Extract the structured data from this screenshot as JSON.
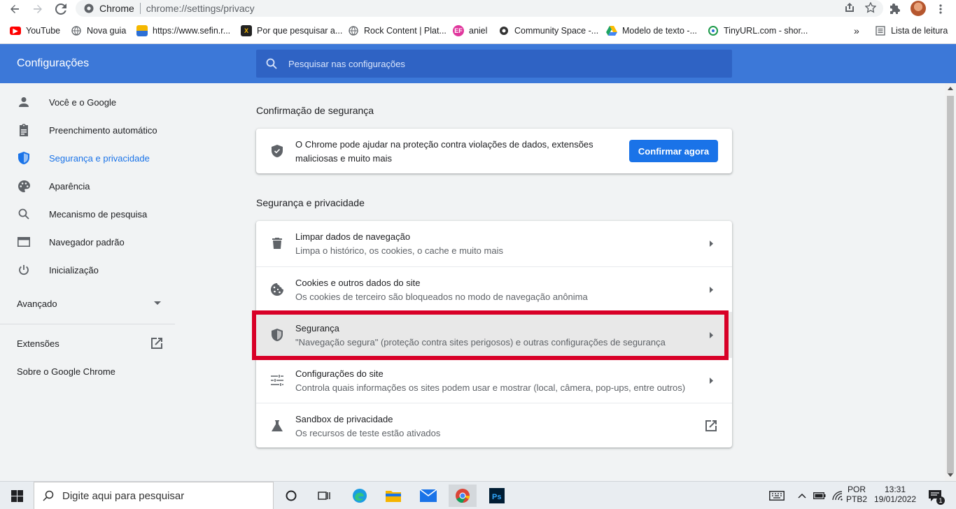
{
  "browser": {
    "site_name": "Chrome",
    "url": "chrome://settings/privacy"
  },
  "bookmarks": [
    {
      "label": "YouTube"
    },
    {
      "label": "Nova guia"
    },
    {
      "label": "https://www.sefin.r..."
    },
    {
      "label": "Por que pesquisar a..."
    },
    {
      "label": "Rock Content | Plat..."
    },
    {
      "label": "aniel"
    },
    {
      "label": "Community Space -..."
    },
    {
      "label": "Modelo de texto -..."
    },
    {
      "label": "TinyURL.com - shor..."
    }
  ],
  "bookmarks_more": "»",
  "reading_list": "Lista de leitura",
  "header": {
    "title": "Configurações",
    "search_placeholder": "Pesquisar nas configurações"
  },
  "sidebar": {
    "items": [
      {
        "label": "Você e o Google"
      },
      {
        "label": "Preenchimento automático"
      },
      {
        "label": "Segurança e privacidade"
      },
      {
        "label": "Aparência"
      },
      {
        "label": "Mecanismo de pesquisa"
      },
      {
        "label": "Navegador padrão"
      },
      {
        "label": "Inicialização"
      }
    ],
    "advanced": "Avançado",
    "extensions": "Extensões",
    "about": "Sobre o Google Chrome"
  },
  "safety_check": {
    "title": "Confirmação de segurança",
    "text": "O Chrome pode ajudar na proteção contra violações de dados, extensões maliciosas e muito mais",
    "button": "Confirmar agora"
  },
  "privacy": {
    "title": "Segurança e privacidade",
    "rows": [
      {
        "title": "Limpar dados de navegação",
        "sub": "Limpa o histórico, os cookies, o cache e muito mais"
      },
      {
        "title": "Cookies e outros dados do site",
        "sub": "Os cookies de terceiro são bloqueados no modo de navegação anônima"
      },
      {
        "title": "Segurança",
        "sub": "\"Navegação segura\" (proteção contra sites perigosos) e outras configurações de segurança"
      },
      {
        "title": "Configurações do site",
        "sub": "Controla quais informações os sites podem usar e mostrar (local, câmera, pop-ups, entre outros)"
      },
      {
        "title": "Sandbox de privacidade",
        "sub": "Os recursos de teste estão ativados"
      }
    ]
  },
  "taskbar": {
    "search_placeholder": "Digite aqui para pesquisar",
    "lang_top": "POR",
    "lang_bottom": "PTB2",
    "time": "13:31",
    "date": "19/01/2022",
    "notification_count": "1"
  },
  "colors": {
    "header_bg": "#3c78d8",
    "accent": "#1a73e8",
    "highlight_border": "#d80027"
  }
}
